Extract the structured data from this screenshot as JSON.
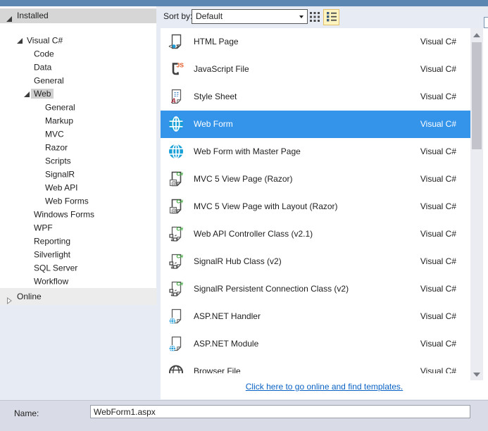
{
  "sidebar": {
    "installed": {
      "label": "Installed",
      "expanded": true
    },
    "online": {
      "label": "Online",
      "expanded": false
    },
    "tree": [
      {
        "label": "Visual C#",
        "level": 0,
        "arrow": "expanded"
      },
      {
        "label": "Code",
        "level": 1
      },
      {
        "label": "Data",
        "level": 1
      },
      {
        "label": "General",
        "level": 1
      },
      {
        "label": "Web",
        "level": 1,
        "arrow": "expanded",
        "selected": true
      },
      {
        "label": "General",
        "level": 2
      },
      {
        "label": "Markup",
        "level": 2
      },
      {
        "label": "MVC",
        "level": 2
      },
      {
        "label": "Razor",
        "level": 2
      },
      {
        "label": "Scripts",
        "level": 2
      },
      {
        "label": "SignalR",
        "level": 2
      },
      {
        "label": "Web API",
        "level": 2
      },
      {
        "label": "Web Forms",
        "level": 2
      },
      {
        "label": "Windows Forms",
        "level": 1
      },
      {
        "label": "WPF",
        "level": 1
      },
      {
        "label": "Reporting",
        "level": 1
      },
      {
        "label": "Silverlight",
        "level": 1
      },
      {
        "label": "SQL Server",
        "level": 1
      },
      {
        "label": "Workflow",
        "level": 1
      }
    ]
  },
  "toolbar": {
    "sort_by_label": "Sort by:",
    "sort_by_value": "Default",
    "view_modes": [
      {
        "name": "small-icons-view",
        "icon": "grid-icon",
        "selected": false
      },
      {
        "name": "list-view",
        "icon": "list-icon",
        "selected": true
      }
    ]
  },
  "templates": {
    "items": [
      {
        "name": "HTML Page",
        "language": "Visual C#",
        "icon": "html-page"
      },
      {
        "name": "JavaScript File",
        "language": "Visual C#",
        "icon": "javascript-file"
      },
      {
        "name": "Style Sheet",
        "language": "Visual C#",
        "icon": "style-sheet"
      },
      {
        "name": "Web Form",
        "language": "Visual C#",
        "icon": "web-form-globe",
        "selected": true
      },
      {
        "name": "Web Form with Master Page",
        "language": "Visual C#",
        "icon": "web-form-globe"
      },
      {
        "name": "MVC 5 View Page (Razor)",
        "language": "Visual C#",
        "icon": "razor-page"
      },
      {
        "name": "MVC 5 View Page with Layout (Razor)",
        "language": "Visual C#",
        "icon": "razor-page"
      },
      {
        "name": "Web API Controller Class (v2.1)",
        "language": "Visual C#",
        "icon": "csharp-class"
      },
      {
        "name": "SignalR Hub Class (v2)",
        "language": "Visual C#",
        "icon": "csharp-class"
      },
      {
        "name": "SignalR Persistent Connection Class (v2)",
        "language": "Visual C#",
        "icon": "csharp-class"
      },
      {
        "name": "ASP.NET Handler",
        "language": "Visual C#",
        "icon": "aspnet-file"
      },
      {
        "name": "ASP.NET Module",
        "language": "Visual C#",
        "icon": "aspnet-file"
      },
      {
        "name": "Browser File",
        "language": "Visual C#",
        "icon": "browser-file",
        "partial": true
      }
    ],
    "online_link": "Click here to go online and find templates."
  },
  "footer": {
    "name_label": "Name:",
    "name_value": "WebForm1.aspx"
  },
  "colors": {
    "titlebar_blue": "#5c87b2",
    "selection_blue": "#3494ea",
    "globe_blue": "#18a0d7",
    "link_blue": "#0a62c5",
    "view_button_highlight": "#fdf4bf"
  }
}
